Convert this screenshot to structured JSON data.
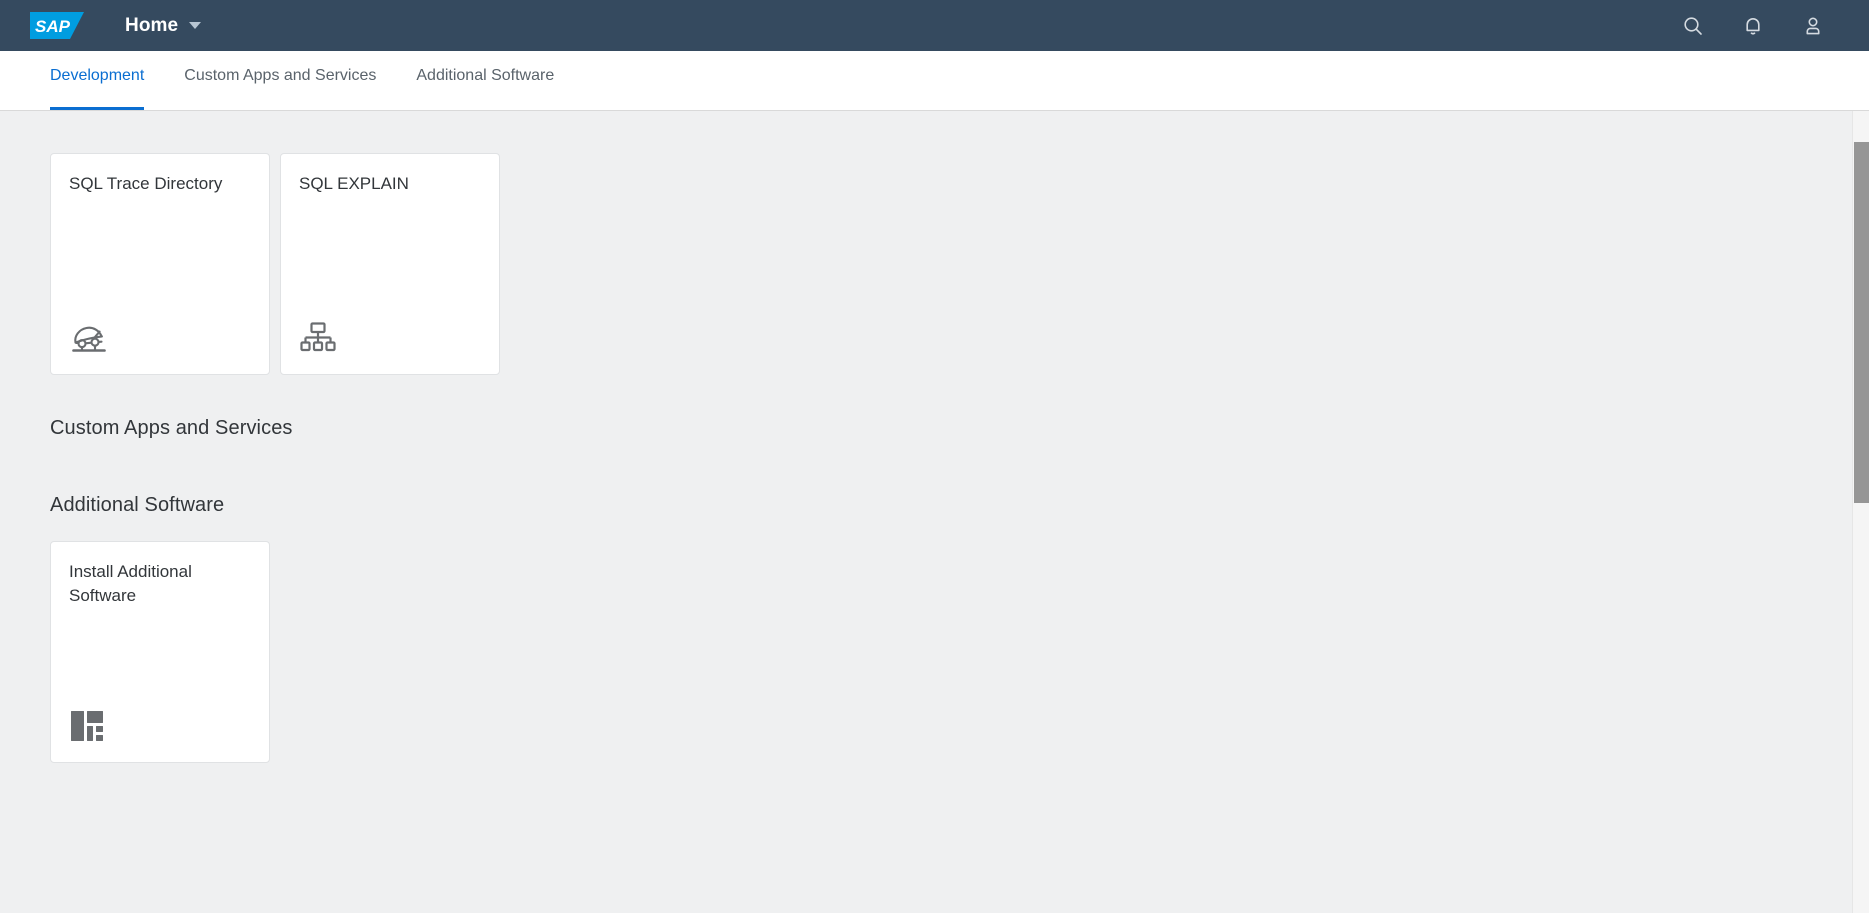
{
  "header": {
    "logo_text": "SAP",
    "logo_name": "sap-logo",
    "title": "Home",
    "caret_name": "chevron-down-icon",
    "actions": [
      {
        "name": "search-icon",
        "label": "Search"
      },
      {
        "name": "bell-icon",
        "label": "Notifications"
      },
      {
        "name": "user-avatar-icon",
        "label": "User"
      }
    ]
  },
  "tabs": [
    {
      "label": "Development",
      "active": true
    },
    {
      "label": "Custom Apps and Services",
      "active": false
    },
    {
      "label": "Additional Software",
      "active": false
    }
  ],
  "sections": [
    {
      "id": "development",
      "title": "",
      "tiles": [
        {
          "title": "SQL Trace Directory",
          "icon": "car-icon"
        },
        {
          "title": "SQL EXPLAIN",
          "icon": "org-chart-icon"
        }
      ]
    },
    {
      "id": "custom-apps-and-services",
      "title": "Custom Apps and Services",
      "tiles": []
    },
    {
      "id": "additional-software",
      "title": "Additional Software",
      "tiles": [
        {
          "title": "Install Additional Software",
          "icon": "modules-icon"
        }
      ]
    }
  ],
  "colors": {
    "shell_background": "#354a5f",
    "accent": "#0a6ed1",
    "page_background": "#eff0f1",
    "tile_background": "#ffffff",
    "text_primary": "#32363a",
    "icon_gray": "#6a6d70",
    "logo_blue": "#009de0"
  },
  "scrollbar": {
    "name": "vertical-scrollbar",
    "thumb_name": "scrollbar-thumb"
  }
}
